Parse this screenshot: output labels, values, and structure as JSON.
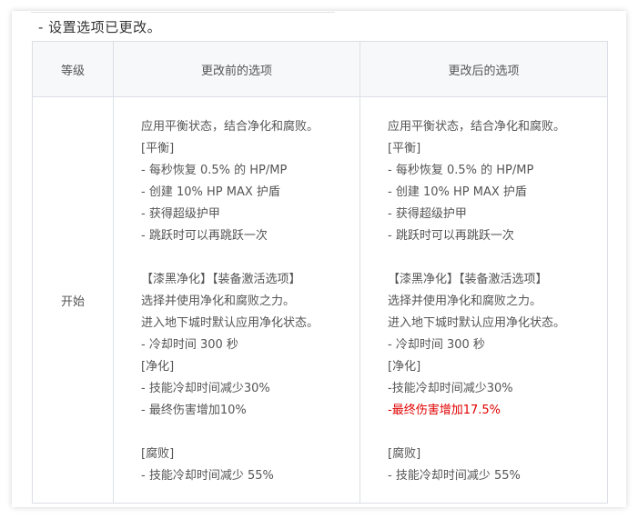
{
  "intro": "- 设置选项已更改。",
  "table": {
    "headers": [
      "等级",
      "更改前的选项",
      "更改后的选项"
    ],
    "row": {
      "level": "开始",
      "before": [
        "应用平衡状态，结合净化和腐败。",
        "[平衡]",
        "- 每秒恢复 0.5% 的 HP/MP",
        "- 创建 10% HP MAX 护盾",
        "- 获得超级护甲",
        "- 跳跃时可以再跳跃一次",
        "",
        "【漆黑净化】【装备激活选项】",
        "选择并使用净化和腐败之力。",
        "进入地下城时默认应用净化状态。",
        "- 冷却时间 300 秒",
        "[净化]",
        "- 技能冷却时间减少30%",
        "- 最终伤害增加10%",
        "",
        "[腐败]",
        "- 技能冷却时间减少 55%"
      ],
      "after": [
        "应用平衡状态，结合净化和腐败。",
        "[平衡]",
        "- 每秒恢复 0.5% 的 HP/MP",
        "- 创建 10% HP MAX 护盾",
        "- 获得超级护甲",
        "- 跳跃时可以再跳跃一次",
        "",
        "【漆黑净化】【装备激活选项】",
        "选择并使用净化和腐败之力。",
        "进入地下城时默认应用净化状态。",
        "- 冷却时间 300 秒",
        "[净化]",
        "-技能冷却时间减少30%",
        "-最终伤害增加17.5%",
        "",
        "[腐败]",
        "- 技能冷却时间减少 55%"
      ],
      "after_highlight_index": 13
    }
  },
  "colors": {
    "highlight": "#e00000",
    "header_bg": "#f7f8fa",
    "border": "#dcdfe6"
  }
}
